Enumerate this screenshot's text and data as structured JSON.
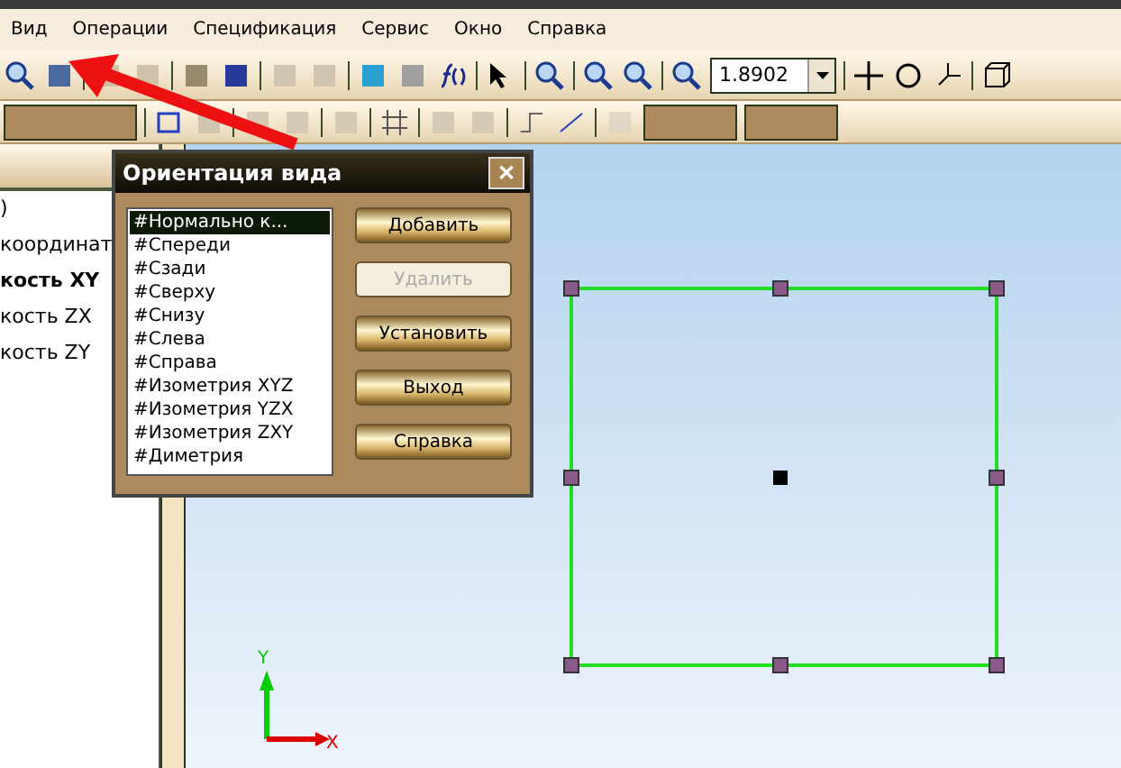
{
  "menu": [
    {
      "label": "Вид"
    },
    {
      "label": "Операции"
    },
    {
      "label": "Спецификация"
    },
    {
      "label": "Сервис"
    },
    {
      "label": "Окно"
    },
    {
      "label": "Справка"
    }
  ],
  "zoom_field": {
    "value": "1.8902"
  },
  "tree": [
    {
      "label": ")",
      "active": false
    },
    {
      "label": "координат",
      "active": false
    },
    {
      "label": "кость XY",
      "active": true
    },
    {
      "label": "кость ZX",
      "active": false
    },
    {
      "label": "кость ZY",
      "active": false
    }
  ],
  "dialog": {
    "title": "Ориентация вида",
    "close": "✕",
    "views": [
      {
        "label": "#Нормально к...",
        "selected": true
      },
      {
        "label": "#Спереди",
        "selected": false
      },
      {
        "label": "#Сзади",
        "selected": false
      },
      {
        "label": "#Сверху",
        "selected": false
      },
      {
        "label": "#Снизу",
        "selected": false
      },
      {
        "label": "#Слева",
        "selected": false
      },
      {
        "label": "#Справа",
        "selected": false
      },
      {
        "label": "#Изометрия XYZ",
        "selected": false
      },
      {
        "label": "#Изометрия YZX",
        "selected": false
      },
      {
        "label": "#Изометрия ZXY",
        "selected": false
      },
      {
        "label": "#Диметрия",
        "selected": false
      }
    ],
    "buttons": [
      {
        "label": "Добавить",
        "disabled": false
      },
      {
        "label": "Удалить",
        "disabled": true
      },
      {
        "label": "Установить",
        "disabled": false
      },
      {
        "label": "Выход",
        "disabled": false
      },
      {
        "label": "Справка",
        "disabled": false
      }
    ]
  },
  "axes": {
    "y": "Y",
    "x": "X"
  }
}
